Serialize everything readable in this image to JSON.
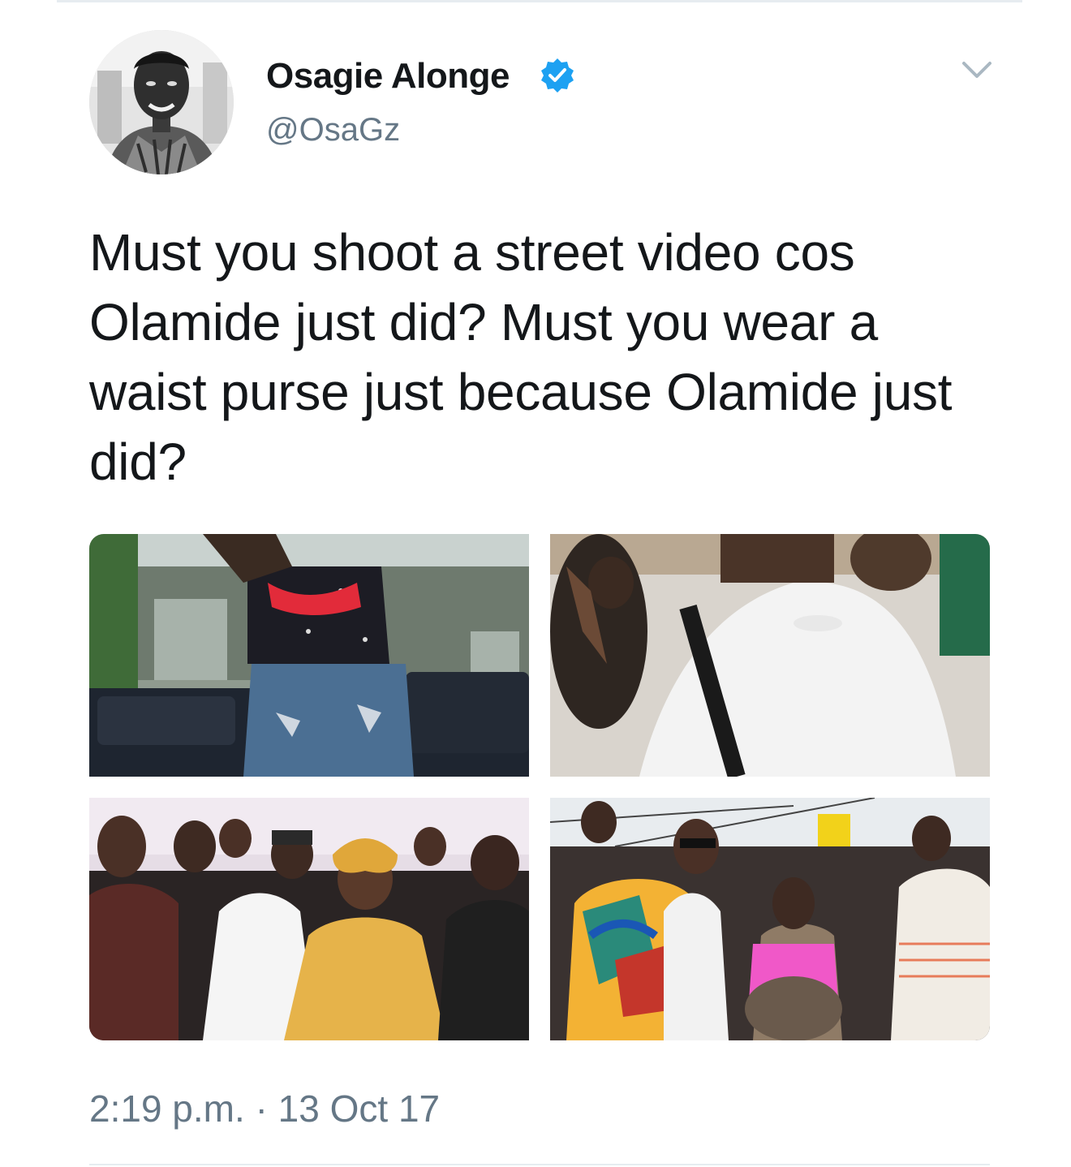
{
  "author": {
    "display_name": "Osagie Alonge",
    "handle": "@OsaGz",
    "verified": true,
    "avatar_icon": "profile-photo"
  },
  "tweet": {
    "text": "Must you shoot a street video cos Olamide just did? Must you wear a waist purse just because Olamide just did?",
    "time": "2:19 p.m.",
    "separator": "·",
    "date": "13 Oct 17"
  },
  "media": {
    "photos": [
      {
        "subject": "man in ripped denim shorts with red waist purse beside a car"
      },
      {
        "subject": "man in white t-shirt with crossbody strap among crowd"
      },
      {
        "subject": "crowd with woman in yellow lace dress and gele"
      },
      {
        "subject": "man in colorful shirt dancing with girl in pink top"
      }
    ]
  },
  "icons": {
    "verified": "verified-badge-icon",
    "caret": "chevron-down-icon"
  },
  "colors": {
    "text_primary": "#14171a",
    "text_secondary": "#657786",
    "verified_blue": "#1da1f2",
    "divider": "#e6ecf0"
  }
}
